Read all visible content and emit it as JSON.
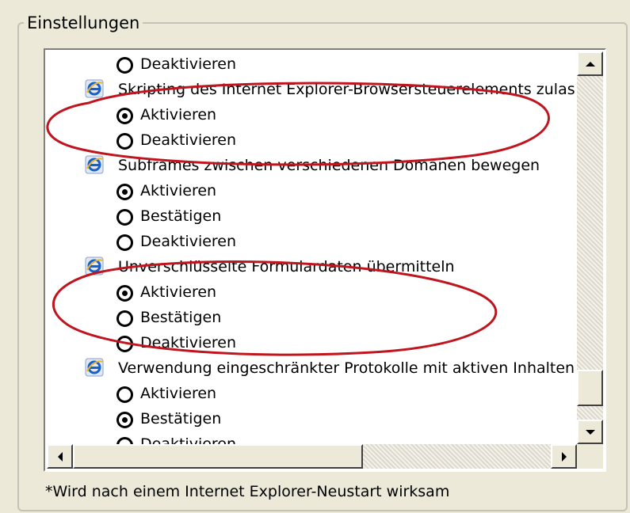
{
  "group": {
    "title": "Einstellungen"
  },
  "rows": [
    {
      "kind": "option",
      "label": "Deaktivieren",
      "checked": false
    },
    {
      "kind": "setting",
      "label": "Skripting des Internet Explorer-Browsersteuerelements zulas"
    },
    {
      "kind": "option",
      "label": "Aktivieren",
      "checked": true
    },
    {
      "kind": "option",
      "label": "Deaktivieren",
      "checked": false
    },
    {
      "kind": "setting",
      "label": "Subframes zwischen verschiedenen Domänen bewegen"
    },
    {
      "kind": "option",
      "label": "Aktivieren",
      "checked": true
    },
    {
      "kind": "option",
      "label": "Bestätigen",
      "checked": false
    },
    {
      "kind": "option",
      "label": "Deaktivieren",
      "checked": false
    },
    {
      "kind": "setting",
      "label": "Unverschlüsselte Formulardaten übermitteln"
    },
    {
      "kind": "option",
      "label": "Aktivieren",
      "checked": true
    },
    {
      "kind": "option",
      "label": "Bestätigen",
      "checked": false
    },
    {
      "kind": "option",
      "label": "Deaktivieren",
      "checked": false
    },
    {
      "kind": "setting",
      "label": "Verwendung eingeschränkter Protokolle mit aktiven Inhalten"
    },
    {
      "kind": "option",
      "label": "Aktivieren",
      "checked": false
    },
    {
      "kind": "option",
      "label": "Bestätigen",
      "checked": true
    },
    {
      "kind": "option",
      "label": "Deaktivieren",
      "checked": false
    }
  ],
  "footnote": "*Wird nach einem Internet Explorer-Neustart wirksam",
  "icons": {
    "setting": "ie-icon",
    "scroll_up": "arrow-up-icon",
    "scroll_down": "arrow-down-icon",
    "scroll_left": "arrow-left-icon",
    "scroll_right": "arrow-right-icon"
  },
  "colors": {
    "annotation": "#c0141e",
    "ie_blue": "#1a5fc6",
    "ie_ring": "#f0b429"
  }
}
